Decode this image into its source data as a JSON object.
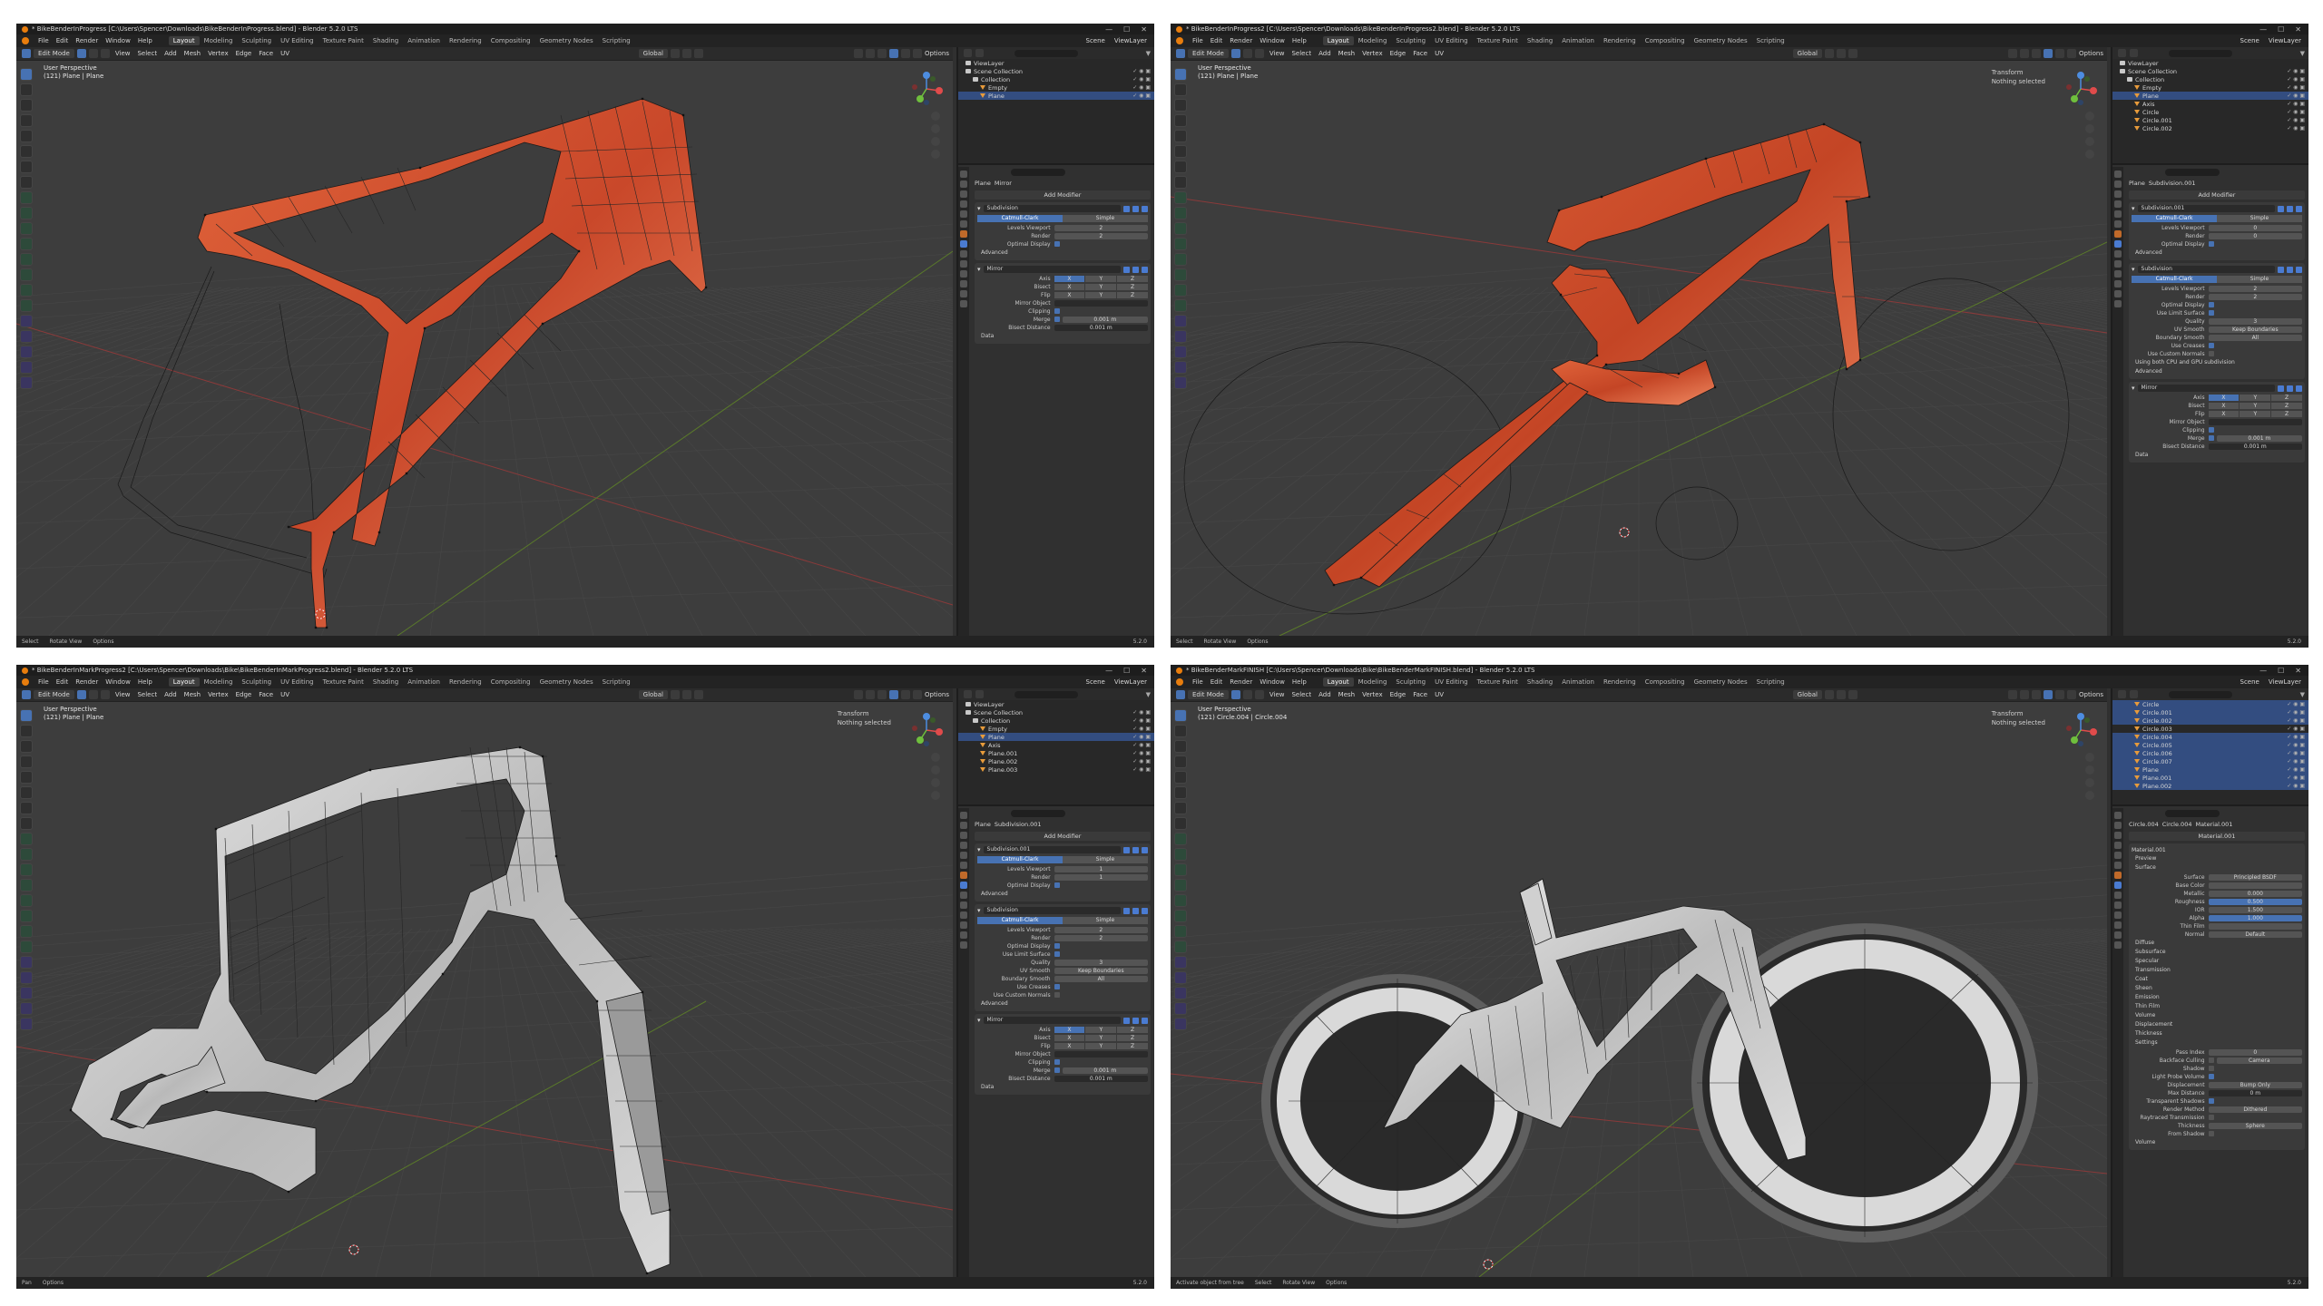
{
  "panels": [
    {
      "title": "* BikeBenderInProgress [C:\\Users\\Spencer\\Downloads\\BikeBenderInProgress.blend] - Blender 5.2.0 LTS",
      "menus": [
        "File",
        "Edit",
        "Render",
        "Window",
        "Help"
      ],
      "workspaces": [
        "Layout",
        "Modeling",
        "Sculpting",
        "UV Editing",
        "Texture Paint",
        "Shading",
        "Animation",
        "Rendering",
        "Compositing",
        "Geometry Nodes",
        "Scripting"
      ],
      "active_workspace": "Layout",
      "scene_label": "Scene",
      "view_layer_label": "ViewLayer",
      "mode": "Edit Mode",
      "header_menus": [
        "View",
        "Select",
        "Add",
        "Mesh",
        "Vertex",
        "Edge",
        "Face",
        "UV"
      ],
      "transform_space": "Global",
      "options_label": "Options",
      "viewport_title": "User Perspective",
      "viewport_sub": "(121) Plane | Plane",
      "nprop": [],
      "outliner": {
        "rows": [
          {
            "label": "ViewLayer",
            "kind": "layer",
            "indent": 0
          },
          {
            "label": "Scene Collection",
            "kind": "collection",
            "indent": 0
          },
          {
            "label": "Collection",
            "kind": "collection",
            "indent": 1
          },
          {
            "label": "Empty",
            "kind": "object",
            "indent": 2
          },
          {
            "label": "Plane",
            "kind": "object",
            "indent": 2,
            "selected": true
          }
        ]
      },
      "props": {
        "breadcrumb": [
          "Plane",
          "Mirror"
        ],
        "add_modifier": "Add Modifier",
        "modifiers": [
          {
            "name": "Subdivision",
            "segments": [
              "Catmull-Clark",
              "Simple"
            ],
            "fields": [
              {
                "label": "Levels Viewport",
                "value": "2"
              },
              {
                "label": "Render",
                "value": "2"
              },
              {
                "label": "Optimal Display",
                "check": true
              }
            ],
            "sections": [
              "Advanced"
            ]
          },
          {
            "name": "Mirror",
            "axis": true,
            "fields": [
              {
                "label": "Mirror Object",
                "value": "",
                "dark": true
              },
              {
                "label": "Clipping",
                "check": true
              },
              {
                "label": "Merge",
                "value": "0.001 m",
                "check": true
              },
              {
                "label": "Bisect Distance",
                "value": "0.001 m",
                "dark": true
              }
            ],
            "sections": [
              "Data"
            ]
          }
        ]
      },
      "status": [
        "Select",
        "Rotate View",
        "Options"
      ],
      "version": "5.2.0"
    },
    {
      "title": "* BikeBenderInProgress2 [C:\\Users\\Spencer\\Downloads\\BikeBenderInProgress2.blend] - Blender 5.2.0 LTS",
      "menus": [
        "File",
        "Edit",
        "Render",
        "Window",
        "Help"
      ],
      "workspaces": [
        "Layout",
        "Modeling",
        "Sculpting",
        "UV Editing",
        "Texture Paint",
        "Shading",
        "Animation",
        "Rendering",
        "Compositing",
        "Geometry Nodes",
        "Scripting"
      ],
      "active_workspace": "Layout",
      "scene_label": "Scene",
      "view_layer_label": "ViewLayer",
      "mode": "Edit Mode",
      "header_menus": [
        "View",
        "Select",
        "Add",
        "Mesh",
        "Vertex",
        "Edge",
        "Face",
        "UV"
      ],
      "transform_space": "Global",
      "options_label": "Options",
      "viewport_title": "User Perspective",
      "viewport_sub": "(121) Plane | Plane",
      "nprop": [
        "Transform",
        "Nothing selected"
      ],
      "outliner": {
        "rows": [
          {
            "label": "ViewLayer",
            "kind": "layer",
            "indent": 0
          },
          {
            "label": "Scene Collection",
            "kind": "collection",
            "indent": 0
          },
          {
            "label": "Collection",
            "kind": "collection",
            "indent": 1
          },
          {
            "label": "Empty",
            "kind": "object",
            "indent": 2
          },
          {
            "label": "Plane",
            "kind": "object",
            "indent": 2,
            "selected": true
          },
          {
            "label": "Axis",
            "kind": "object",
            "indent": 2
          },
          {
            "label": "Circle",
            "kind": "object",
            "indent": 2
          },
          {
            "label": "Circle.001",
            "kind": "object",
            "indent": 2
          },
          {
            "label": "Circle.002",
            "kind": "object",
            "indent": 2
          }
        ]
      },
      "props": {
        "breadcrumb": [
          "Plane",
          "Subdivision.001"
        ],
        "add_modifier": "Add Modifier",
        "modifiers": [
          {
            "name": "Subdivision.001",
            "segments": [
              "Catmull-Clark",
              "Simple"
            ],
            "fields": [
              {
                "label": "Levels Viewport",
                "value": "0"
              },
              {
                "label": "Render",
                "value": "0"
              },
              {
                "label": "Optimal Display",
                "check": true
              }
            ],
            "sections": [
              "Advanced"
            ]
          },
          {
            "name": "Subdivision",
            "segments": [
              "Catmull-Clark",
              "Simple"
            ],
            "fields": [
              {
                "label": "Levels Viewport",
                "value": "2"
              },
              {
                "label": "Render",
                "value": "2"
              },
              {
                "label": "Optimal Display",
                "check": true
              }
            ],
            "sections": [
              "Using both CPU and GPU subdivision",
              "Advanced"
            ],
            "extra": [
              {
                "label": "Use Limit Surface",
                "check": true
              },
              {
                "label": "Quality",
                "value": "3"
              },
              {
                "label": "UV Smooth",
                "value": "Keep Boundaries"
              },
              {
                "label": "Boundary Smooth",
                "value": "All"
              },
              {
                "label": "Use Creases",
                "check": true
              },
              {
                "label": "Use Custom Normals",
                "check": false
              }
            ]
          },
          {
            "name": "Mirror",
            "axis": true,
            "fields": [
              {
                "label": "Mirror Object",
                "value": "",
                "dark": true
              },
              {
                "label": "Clipping",
                "check": true
              },
              {
                "label": "Merge",
                "value": "0.001 m",
                "check": true
              },
              {
                "label": "Bisect Distance",
                "value": "0.001 m",
                "dark": true
              }
            ],
            "sections": [
              "Data"
            ]
          }
        ]
      },
      "status": [
        "Select",
        "Rotate View",
        "Options"
      ],
      "version": "5.2.0"
    },
    {
      "title": "* BikeBenderInMarkProgress2 [C:\\Users\\Spencer\\Downloads\\Bike\\BikeBenderInMarkProgress2.blend] - Blender 5.2.0 LTS",
      "menus": [
        "File",
        "Edit",
        "Render",
        "Window",
        "Help"
      ],
      "workspaces": [
        "Layout",
        "Modeling",
        "Sculpting",
        "UV Editing",
        "Texture Paint",
        "Shading",
        "Animation",
        "Rendering",
        "Compositing",
        "Geometry Nodes",
        "Scripting"
      ],
      "active_workspace": "Layout",
      "scene_label": "Scene",
      "view_layer_label": "ViewLayer",
      "mode": "Edit Mode",
      "header_menus": [
        "View",
        "Select",
        "Add",
        "Mesh",
        "Vertex",
        "Edge",
        "Face",
        "UV"
      ],
      "transform_space": "Global",
      "options_label": "Options",
      "viewport_title": "User Perspective",
      "viewport_sub": "(121) Plane | Plane",
      "nprop": [
        "Transform",
        "Nothing selected"
      ],
      "outliner": {
        "rows": [
          {
            "label": "ViewLayer",
            "kind": "layer",
            "indent": 0
          },
          {
            "label": "Scene Collection",
            "kind": "collection",
            "indent": 0
          },
          {
            "label": "Collection",
            "kind": "collection",
            "indent": 1
          },
          {
            "label": "Empty",
            "kind": "object",
            "indent": 2
          },
          {
            "label": "Plane",
            "kind": "object",
            "indent": 2,
            "selected": true
          },
          {
            "label": "Axis",
            "kind": "object",
            "indent": 2
          },
          {
            "label": "Plane.001",
            "kind": "object",
            "indent": 2
          },
          {
            "label": "Plane.002",
            "kind": "object",
            "indent": 2
          },
          {
            "label": "Plane.003",
            "kind": "object",
            "indent": 2
          }
        ]
      },
      "props": {
        "breadcrumb": [
          "Plane",
          "Subdivision.001"
        ],
        "add_modifier": "Add Modifier",
        "modifiers": [
          {
            "name": "Subdivision.001",
            "segments": [
              "Catmull-Clark",
              "Simple"
            ],
            "fields": [
              {
                "label": "Levels Viewport",
                "value": "1"
              },
              {
                "label": "Render",
                "value": "1"
              },
              {
                "label": "Optimal Display",
                "check": true
              }
            ],
            "sections": [
              "Advanced"
            ]
          },
          {
            "name": "Subdivision",
            "segments": [
              "Catmull-Clark",
              "Simple"
            ],
            "fields": [
              {
                "label": "Levels Viewport",
                "value": "2"
              },
              {
                "label": "Render",
                "value": "2"
              },
              {
                "label": "Optimal Display",
                "check": true
              }
            ],
            "sections": [
              "Advanced"
            ],
            "extra": [
              {
                "label": "Use Limit Surface",
                "check": true
              },
              {
                "label": "Quality",
                "value": "3"
              },
              {
                "label": "UV Smooth",
                "value": "Keep Boundaries"
              },
              {
                "label": "Boundary Smooth",
                "value": "All"
              },
              {
                "label": "Use Creases",
                "check": true
              },
              {
                "label": "Use Custom Normals",
                "check": false
              }
            ]
          },
          {
            "name": "Mirror",
            "axis": true,
            "fields": [
              {
                "label": "Mirror Object",
                "value": "",
                "dark": true
              },
              {
                "label": "Clipping",
                "check": true
              },
              {
                "label": "Merge",
                "value": "0.001 m",
                "check": true
              },
              {
                "label": "Bisect Distance",
                "value": "0.001 m",
                "dark": true
              }
            ],
            "sections": [
              "Data"
            ]
          }
        ]
      },
      "status": [
        "Pan",
        "Options"
      ],
      "version": "5.2.0"
    },
    {
      "title": "* BikeBenderMarkFINISH [C:\\Users\\Spencer\\Downloads\\Bike\\BikeBenderMarkFINISH.blend] - Blender 5.2.0 LTS",
      "menus": [
        "File",
        "Edit",
        "Render",
        "Window",
        "Help"
      ],
      "workspaces": [
        "Layout",
        "Modeling",
        "Sculpting",
        "UV Editing",
        "Texture Paint",
        "Shading",
        "Animation",
        "Rendering",
        "Compositing",
        "Geometry Nodes",
        "Scripting"
      ],
      "active_workspace": "Layout",
      "scene_label": "Scene",
      "view_layer_label": "ViewLayer",
      "mode": "Edit Mode",
      "header_menus": [
        "View",
        "Select",
        "Add",
        "Mesh",
        "Vertex",
        "Edge",
        "Face",
        "UV"
      ],
      "transform_space": "Global",
      "options_label": "Options",
      "viewport_title": "User Perspective",
      "viewport_sub": "(121) Circle.004 | Circle.004",
      "nprop": [
        "Transform",
        "Nothing selected"
      ],
      "outliner": {
        "rows": [
          {
            "label": "Circle",
            "kind": "object",
            "indent": 2,
            "selected": true
          },
          {
            "label": "Circle.001",
            "kind": "object",
            "indent": 2,
            "selected": true
          },
          {
            "label": "Circle.002",
            "kind": "object",
            "indent": 2,
            "selected": true
          },
          {
            "label": "Circle.003",
            "kind": "object",
            "indent": 2
          },
          {
            "label": "Circle.004",
            "kind": "object",
            "indent": 2,
            "selected": true
          },
          {
            "label": "Circle.005",
            "kind": "object",
            "indent": 2,
            "selected": true
          },
          {
            "label": "Circle.006",
            "kind": "object",
            "indent": 2,
            "selected": true
          },
          {
            "label": "Circle.007",
            "kind": "object",
            "indent": 2,
            "selected": true
          },
          {
            "label": "Plane",
            "kind": "object",
            "indent": 2,
            "selected": true
          },
          {
            "label": "Plane.001",
            "kind": "object",
            "indent": 2,
            "selected": true
          },
          {
            "label": "Plane.002",
            "kind": "object",
            "indent": 2,
            "selected": true
          }
        ]
      },
      "props": {
        "breadcrumb": [
          "Circle.004",
          "Circle.004",
          "Material.001"
        ],
        "add_modifier": "Material.001",
        "material": {
          "slot": "Material.001",
          "tabs": [
            "Preview",
            "Surface"
          ],
          "surface_shader": "Principled BSDF",
          "fields": [
            {
              "label": "Surface",
              "value": "Principled BSDF"
            },
            {
              "label": "Base Color",
              "value": ""
            },
            {
              "label": "Metallic",
              "value": "0.000"
            },
            {
              "label": "Roughness",
              "value": "0.500",
              "blue": true
            },
            {
              "label": "IOR",
              "value": "1.500"
            },
            {
              "label": "Alpha",
              "value": "1.000",
              "blue": true
            },
            {
              "label": "Thin Film",
              "value": ""
            },
            {
              "label": "Normal",
              "value": "Default"
            }
          ],
          "subsections": [
            "Diffuse",
            "Subsurface",
            "Specular",
            "Transmission",
            "Coat",
            "Sheen",
            "Emission",
            "Thin Film"
          ],
          "lower_sections": [
            "Volume",
            "Displacement",
            "Thickness",
            "Settings"
          ],
          "settings": [
            {
              "label": "Pass Index",
              "value": "0"
            },
            {
              "label": "Backface Culling",
              "check": false,
              "value": "Camera"
            },
            {
              "label": "Shadow",
              "check": false
            },
            {
              "label": "Light Probe Volume",
              "check": true
            },
            {
              "label": "Displacement",
              "value": "Bump Only"
            },
            {
              "label": "Max Distance",
              "value": "0 m",
              "dark": true
            },
            {
              "label": "Transparent Shadows",
              "check": true
            },
            {
              "label": "Render Method",
              "value": "Dithered"
            },
            {
              "label": "Raytraced Transmission",
              "check": false
            },
            {
              "label": "Thickness",
              "value": "Sphere"
            },
            {
              "label": "From Shadow",
              "check": false
            }
          ],
          "footer": "Volume"
        }
      },
      "status": [
        "Activate object from tree",
        "Select",
        "Rotate View",
        "Options"
      ],
      "version": "5.2.0"
    }
  ],
  "colors": {
    "frame_orange": "#d4522b",
    "frame_gray": "#c7c7c7",
    "viewport_bg": "#3d3d3d",
    "accent_blue": "#4772b3",
    "wireframe": "#1a1a1a"
  }
}
